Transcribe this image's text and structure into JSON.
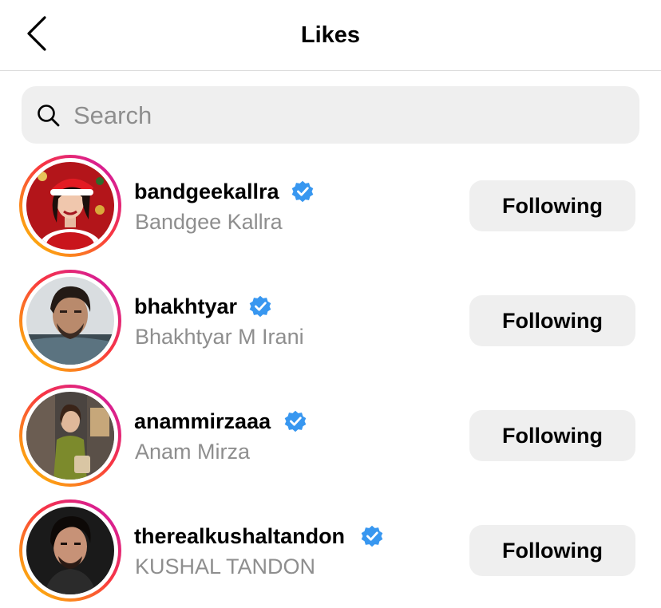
{
  "header": {
    "title": "Likes"
  },
  "search": {
    "placeholder": "Search",
    "value": ""
  },
  "users": [
    {
      "username": "bandgeekallra",
      "full_name": "Bandgee Kallra",
      "verified": true,
      "button_label": "Following"
    },
    {
      "username": "bhakhtyar",
      "full_name": "Bhakhtyar M Irani",
      "verified": true,
      "button_label": "Following"
    },
    {
      "username": "anammirzaaa",
      "full_name": "Anam Mirza",
      "verified": true,
      "button_label": "Following"
    },
    {
      "username": "therealkushaltandon",
      "full_name": "KUSHAL TANDON",
      "verified": true,
      "button_label": "Following"
    }
  ],
  "colors": {
    "verified_badge": "#3897f0",
    "button_bg": "#efefef",
    "secondary_text": "#8e8e8e",
    "story_ring": [
      "#c913b9",
      "#f9373f",
      "#fecd00"
    ]
  }
}
